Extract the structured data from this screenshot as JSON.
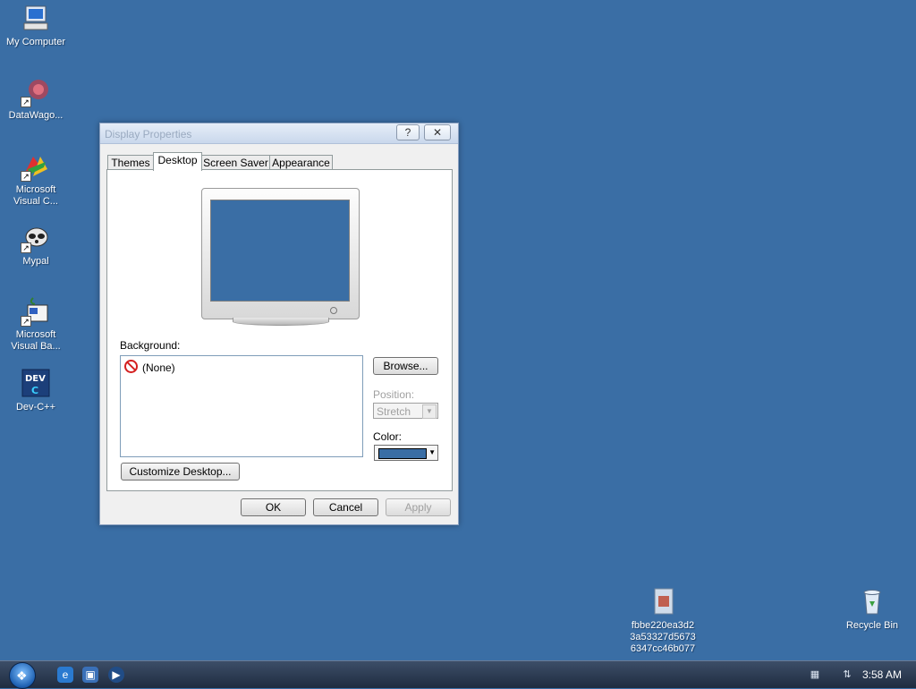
{
  "desktop": {
    "background_color": "#3a6ea5",
    "icons": [
      {
        "label": "My Computer",
        "icon": "computer-icon"
      },
      {
        "label": "DataWago...",
        "icon": "datawagon-icon"
      },
      {
        "label_line1": "Microsoft",
        "label_line2": "Visual C...",
        "icon": "visual-cpp-icon"
      },
      {
        "label": "Mypal",
        "icon": "raccoon-icon"
      },
      {
        "label_line1": "Microsoft",
        "label_line2": "Visual Ba...",
        "icon": "visual-basic-icon"
      },
      {
        "label": "Dev-C++",
        "icon": "devcpp-icon"
      },
      {
        "label_line1": "fbbe220ea3d2",
        "label_line2": "3a53327d5673",
        "label_line3": "6347cc46b077",
        "icon": "file-icon"
      },
      {
        "label": "Recycle Bin",
        "icon": "recycle-bin-icon"
      }
    ]
  },
  "dialog": {
    "title": "Display Properties",
    "help_glyph": "?",
    "close_glyph": "✕",
    "tabs": [
      {
        "label": "Themes"
      },
      {
        "label": "Desktop",
        "active": true
      },
      {
        "label": "Screen Saver"
      },
      {
        "label": "Appearance"
      }
    ],
    "preview_color": "#3a6ea5",
    "background_label": "Background:",
    "background_items": [
      {
        "label": "(None)",
        "icon": "none-icon"
      }
    ],
    "browse_label": "Browse...",
    "position_label": "Position:",
    "position_value": "Stretch",
    "color_label": "Color:",
    "color_value": "#3a6ea5",
    "customize_label": "Customize Desktop...",
    "ok_label": "OK",
    "cancel_label": "Cancel",
    "apply_label": "Apply"
  },
  "taskbar": {
    "clock": "3:58 AM",
    "quick_launch": [
      "internet-explorer-icon",
      "media-icon",
      "media-player-icon"
    ],
    "tray": [
      "keyboard-icon",
      "network-icon"
    ]
  }
}
